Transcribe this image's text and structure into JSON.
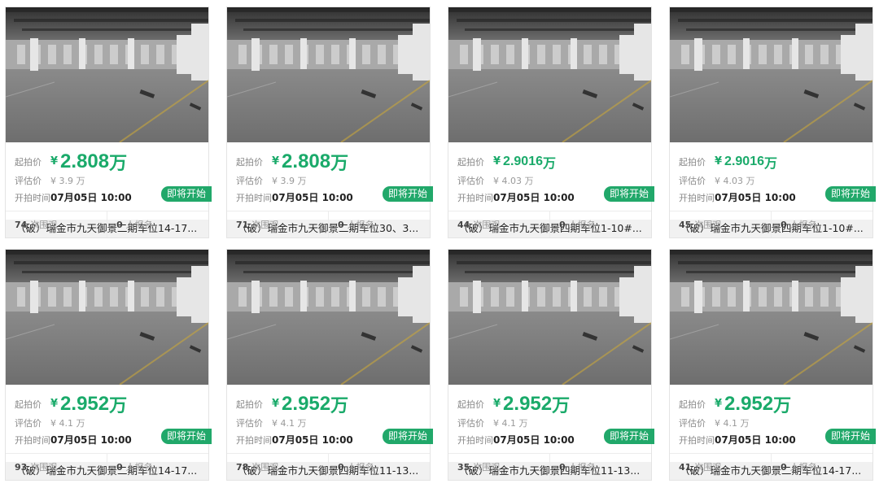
{
  "labels": {
    "start_price": "起拍价",
    "estimate": "评估价",
    "start_time": "开拍时间",
    "currency": "¥",
    "unit": "万",
    "views_suffix": "次围观",
    "signups_suffix": "人报名",
    "badge": "即将开始"
  },
  "accent_color": "#1aaa6a",
  "badge_color": "#21a86a",
  "cards": [
    {
      "title": "（破）瑞金市九天御景二期车位14-17...",
      "price": "2.808",
      "estimate": "¥ 3.9 万",
      "time": "07月05日 10:00",
      "views": "74",
      "signups": "0"
    },
    {
      "title": "（破）瑞金市九天御景二期车位30、3...",
      "price": "2.808",
      "estimate": "¥ 3.9 万",
      "time": "07月05日 10:00",
      "views": "71",
      "signups": "0"
    },
    {
      "title": "（破）瑞金市九天御景四期车位1-10#...",
      "price": "2.9016",
      "estimate": "¥ 4.03 万",
      "time": "07月05日 10:00",
      "views": "44",
      "signups": "0"
    },
    {
      "title": "（破）瑞金市九天御景四期车位1-10#...",
      "price": "2.9016",
      "estimate": "¥ 4.03 万",
      "time": "07月05日 10:00",
      "views": "45",
      "signups": "0"
    },
    {
      "title": "（破）瑞金市九天御景二期车位14-17...",
      "price": "2.952",
      "estimate": "¥ 4.1 万",
      "time": "07月05日 10:00",
      "views": "93",
      "signups": "0"
    },
    {
      "title": "（破）瑞金市九天御景四期车位11-13...",
      "price": "2.952",
      "estimate": "¥ 4.1 万",
      "time": "07月05日 10:00",
      "views": "78",
      "signups": "0"
    },
    {
      "title": "（破）瑞金市九天御景四期车位11-13...",
      "price": "2.952",
      "estimate": "¥ 4.1 万",
      "time": "07月05日 10:00",
      "views": "35",
      "signups": "0"
    },
    {
      "title": "（破）瑞金市九天御景二期车位14-17...",
      "price": "2.952",
      "estimate": "¥ 4.1 万",
      "time": "07月05日 10:00",
      "views": "41",
      "signups": "0"
    }
  ]
}
